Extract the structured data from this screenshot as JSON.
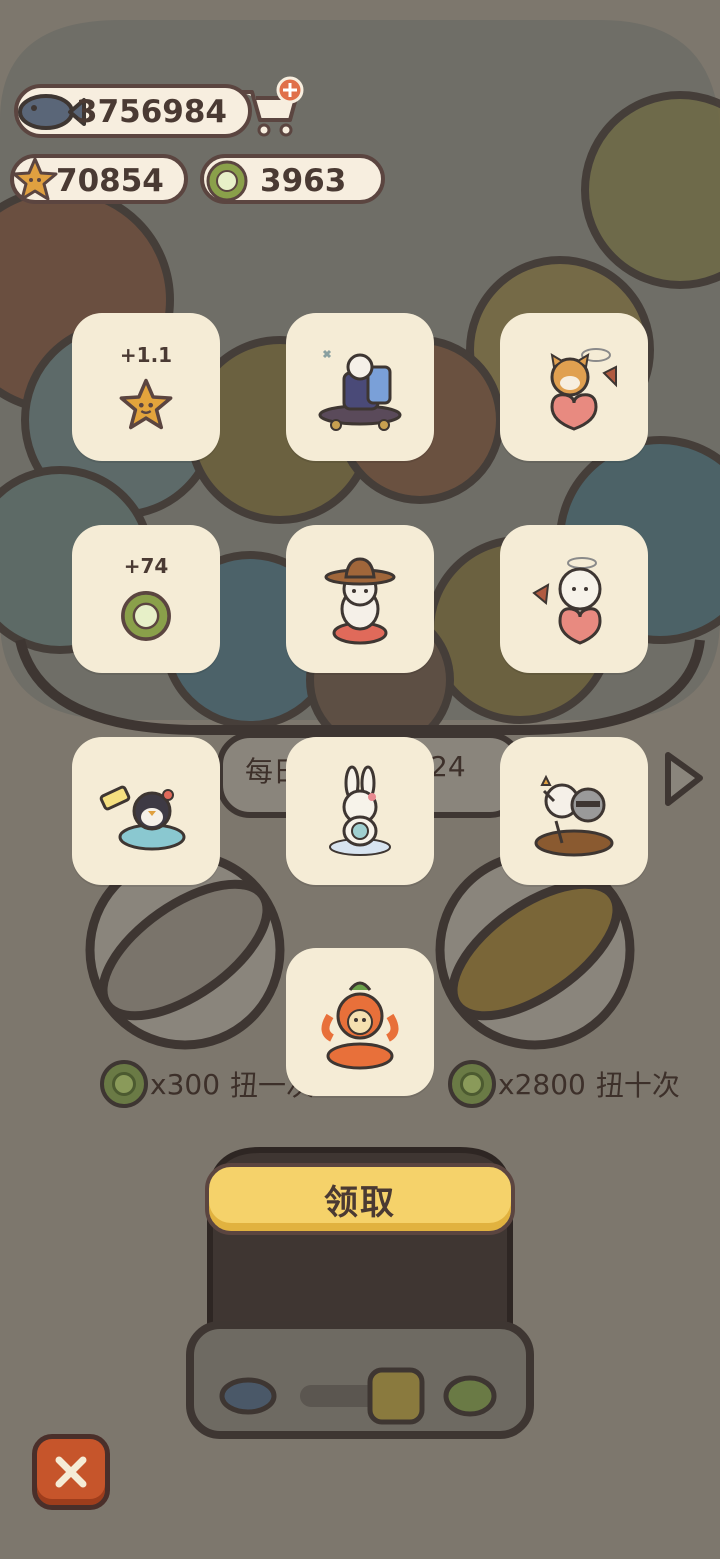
{
  "currencies": {
    "fish": "3756984",
    "stars": "70854",
    "coins": "3963"
  },
  "rewards": [
    {
      "type": "star",
      "amount": "+1.1",
      "icon": "star-icon"
    },
    {
      "type": "item",
      "icon": "raccoon-skateboard-charm"
    },
    {
      "type": "item",
      "icon": "shiba-heart-charm"
    },
    {
      "type": "coin",
      "amount": "+74",
      "icon": "coin-icon"
    },
    {
      "type": "item",
      "icon": "cowboy-cat-charm"
    },
    {
      "type": "item",
      "icon": "angel-sheep-heart-charm"
    },
    {
      "type": "item",
      "icon": "penguin-bath-charm"
    },
    {
      "type": "item",
      "icon": "bunny-cloud-charm"
    },
    {
      "type": "item",
      "icon": "cat-raccoon-boat-charm"
    },
    {
      "type": "item",
      "icon": "carrot-bunny-charm"
    }
  ],
  "daily": {
    "left": "每日",
    "right": "24"
  },
  "spin_once": {
    "cost": "x300",
    "label": "扭一次"
  },
  "spin_ten": {
    "cost": "x2800",
    "label": "扭十次"
  },
  "claim_button": "领取",
  "colors": {
    "accent": "#f5d26a",
    "card": "#f5ecd6",
    "close": "#c6552b",
    "outline": "#5b4540"
  }
}
